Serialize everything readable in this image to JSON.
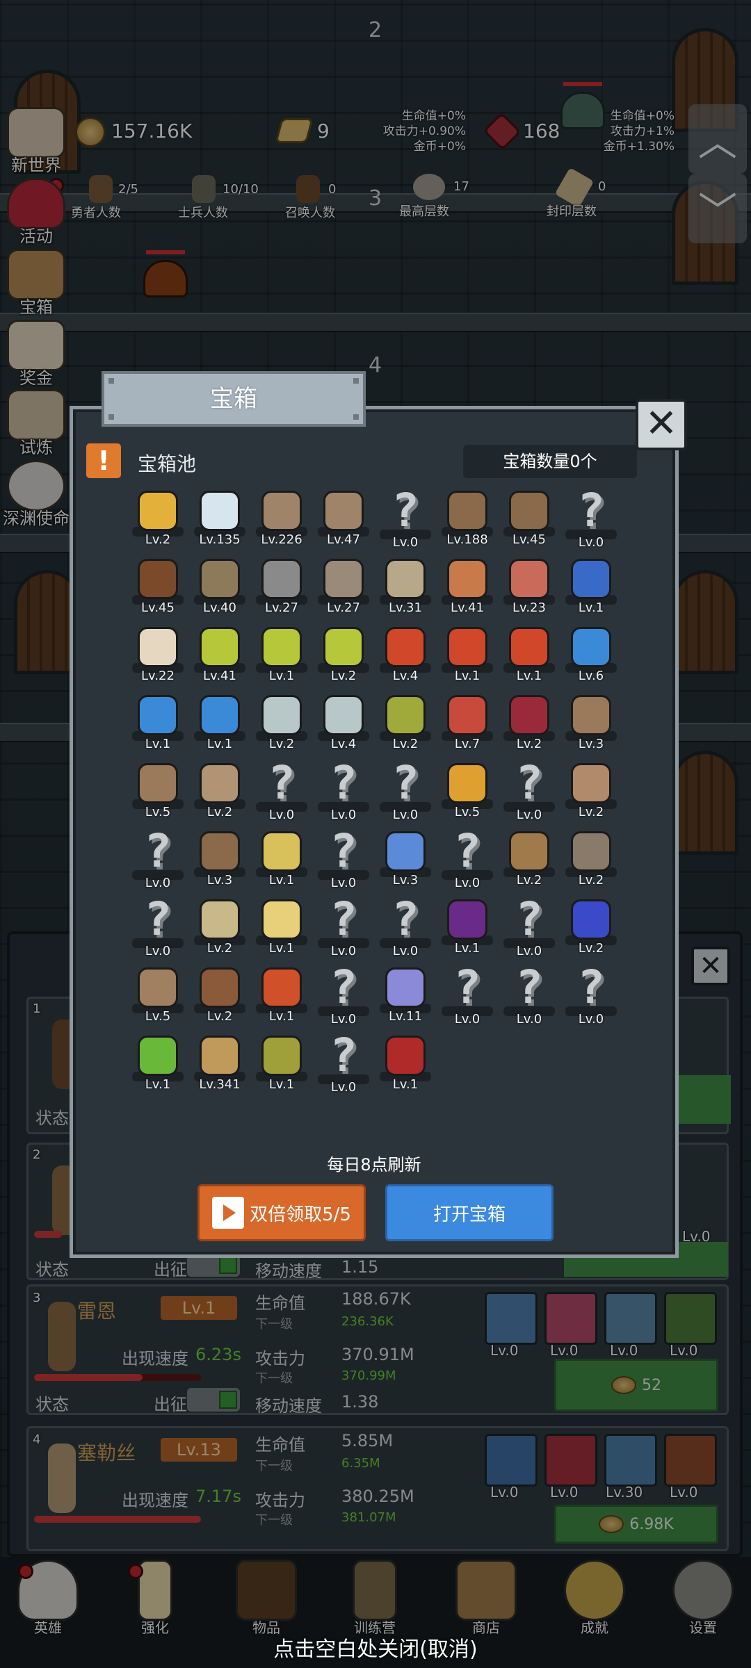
{
  "floors": {
    "top": "2",
    "mid": "3",
    "low": "4"
  },
  "resources": {
    "gold": "157.16K",
    "gold_bonus": [
      "生命值+0%",
      "攻击力+0.90%",
      "金币+0%"
    ],
    "bar_count": "9",
    "gem": "168",
    "gem_bonus": [
      "生命值+0%",
      "攻击力+1%",
      "金币+1.30%"
    ]
  },
  "stats": [
    {
      "value": "2/5",
      "label": "勇者人数"
    },
    {
      "value": "10/10",
      "label": "士兵人数"
    },
    {
      "value": "0",
      "label": "召唤人数"
    },
    {
      "value": "17",
      "label": "最高层数"
    },
    {
      "value": "0",
      "label": "封印层数"
    }
  ],
  "side_menu": [
    "新世界",
    "活动",
    "宝箱",
    "奖金",
    "试炼",
    "深渊使命"
  ],
  "modal": {
    "title": "宝箱",
    "pool_label": "宝箱池",
    "chest_count": "宝箱数量0个",
    "refresh_note": "每日8点刷新",
    "double_btn": "双倍领取5/5",
    "open_btn": "打开宝箱",
    "close_glyph": "✕",
    "alert_glyph": "!",
    "unknown_glyph": "?"
  },
  "items": [
    {
      "name": "crown",
      "lv": "Lv.2"
    },
    {
      "name": "diamond",
      "lv": "Lv.135"
    },
    {
      "name": "sword",
      "lv": "Lv.226"
    },
    {
      "name": "sword",
      "lv": "Lv.47"
    },
    {
      "name": "unknown",
      "lv": "Lv.0"
    },
    {
      "name": "backpack",
      "lv": "Lv.188"
    },
    {
      "name": "backpack",
      "lv": "Lv.45"
    },
    {
      "name": "unknown",
      "lv": "Lv.0"
    },
    {
      "name": "helmet",
      "lv": "Lv.45"
    },
    {
      "name": "dagger",
      "lv": "Lv.40"
    },
    {
      "name": "knight-helmet",
      "lv": "Lv.27"
    },
    {
      "name": "hammer",
      "lv": "Lv.27"
    },
    {
      "name": "great-helm",
      "lv": "Lv.31"
    },
    {
      "name": "ham",
      "lv": "Lv.41"
    },
    {
      "name": "steak",
      "lv": "Lv.23"
    },
    {
      "name": "pouch",
      "lv": "Lv.1"
    },
    {
      "name": "bread",
      "lv": "Lv.22"
    },
    {
      "name": "yellow-potion",
      "lv": "Lv.41"
    },
    {
      "name": "yellow-potion",
      "lv": "Lv.1"
    },
    {
      "name": "yellow-potion",
      "lv": "Lv.2"
    },
    {
      "name": "red-potion",
      "lv": "Lv.4"
    },
    {
      "name": "red-potion",
      "lv": "Lv.1"
    },
    {
      "name": "red-potion",
      "lv": "Lv.1"
    },
    {
      "name": "blue-potion",
      "lv": "Lv.6"
    },
    {
      "name": "blue-potion",
      "lv": "Lv.1"
    },
    {
      "name": "blue-potion",
      "lv": "Lv.1"
    },
    {
      "name": "vial",
      "lv": "Lv.2"
    },
    {
      "name": "vial",
      "lv": "Lv.4"
    },
    {
      "name": "green-vial",
      "lv": "Lv.2"
    },
    {
      "name": "red-vial",
      "lv": "Lv.7"
    },
    {
      "name": "winged-boot",
      "lv": "Lv.2"
    },
    {
      "name": "boot",
      "lv": "Lv.3"
    },
    {
      "name": "boot",
      "lv": "Lv.5"
    },
    {
      "name": "shield",
      "lv": "Lv.2"
    },
    {
      "name": "unknown",
      "lv": "Lv.0"
    },
    {
      "name": "unknown",
      "lv": "Lv.0"
    },
    {
      "name": "unknown",
      "lv": "Lv.0"
    },
    {
      "name": "torch",
      "lv": "Lv.5"
    },
    {
      "name": "unknown",
      "lv": "Lv.0"
    },
    {
      "name": "mushroom",
      "lv": "Lv.2"
    },
    {
      "name": "unknown",
      "lv": "Lv.0"
    },
    {
      "name": "staff",
      "lv": "Lv.3"
    },
    {
      "name": "lemons",
      "lv": "Lv.1"
    },
    {
      "name": "unknown",
      "lv": "Lv.0"
    },
    {
      "name": "wand",
      "lv": "Lv.3"
    },
    {
      "name": "unknown",
      "lv": "Lv.0"
    },
    {
      "name": "bag",
      "lv": "Lv.2"
    },
    {
      "name": "shovel",
      "lv": "Lv.2"
    },
    {
      "name": "unknown",
      "lv": "Lv.0"
    },
    {
      "name": "club",
      "lv": "Lv.2"
    },
    {
      "name": "cheese",
      "lv": "Lv.1"
    },
    {
      "name": "unknown",
      "lv": "Lv.0"
    },
    {
      "name": "unknown",
      "lv": "Lv.0"
    },
    {
      "name": "crystal",
      "lv": "Lv.1"
    },
    {
      "name": "unknown",
      "lv": "Lv.0"
    },
    {
      "name": "orb",
      "lv": "Lv.2"
    },
    {
      "name": "bow",
      "lv": "Lv.5"
    },
    {
      "name": "quiver",
      "lv": "Lv.2"
    },
    {
      "name": "flame-banner",
      "lv": "Lv.1"
    },
    {
      "name": "unknown",
      "lv": "Lv.0"
    },
    {
      "name": "eye-monster",
      "lv": "Lv.11"
    },
    {
      "name": "unknown",
      "lv": "Lv.0"
    },
    {
      "name": "unknown",
      "lv": "Lv.0"
    },
    {
      "name": "unknown",
      "lv": "Lv.0"
    },
    {
      "name": "green-staff",
      "lv": "Lv.1"
    },
    {
      "name": "beer",
      "lv": "Lv.341"
    },
    {
      "name": "vine",
      "lv": "Lv.1"
    },
    {
      "name": "unknown",
      "lv": "Lv.0"
    },
    {
      "name": "spellbook",
      "lv": "Lv.1"
    }
  ],
  "heroes": [
    {
      "idx": "1"
    },
    {
      "idx": "2",
      "status": "状态",
      "deploy": "出征",
      "move_label": "移动速度",
      "move": "1.15",
      "skill_lv": "Lv.0"
    },
    {
      "idx": "3",
      "name": "雷恩",
      "level": "Lv.1",
      "spawn_label": "出现速度",
      "spawn": "6.23s",
      "hp_label": "生命值",
      "hp": "188.67K",
      "next_label": "下一级",
      "hp_next": "236.36K",
      "atk_label": "攻击力",
      "atk": "370.91M",
      "atk_next": "370.99M",
      "move_label": "移动速度",
      "move": "1.38",
      "status": "状态",
      "deploy": "出征",
      "skills": [
        "Lv.0",
        "Lv.0",
        "Lv.0",
        "Lv.0"
      ],
      "cost": "52"
    },
    {
      "idx": "4",
      "name": "塞勒丝",
      "level": "Lv.13",
      "spawn_label": "出现速度",
      "spawn": "7.17s",
      "hp_label": "生命值",
      "hp": "5.85M",
      "next_label": "下一级",
      "hp_next": "6.35M",
      "atk_label": "攻击力",
      "atk": "380.25M",
      "atk_next": "381.07M",
      "skills": [
        "Lv.0",
        "Lv.0",
        "Lv.30",
        "Lv.0"
      ],
      "cost": "6.98K"
    }
  ],
  "hero1_status": "状态",
  "bottom_nav": [
    "英雄",
    "强化",
    "物品",
    "训练营",
    "商店",
    "成就",
    "设置"
  ],
  "close_hint": "点击空白处关闭(取消)",
  "colors": {
    "accent_orange": "#d8692b",
    "accent_blue": "#3c8ae0",
    "green_btn": "#3f8c46",
    "level_badge": "#b5672b"
  }
}
